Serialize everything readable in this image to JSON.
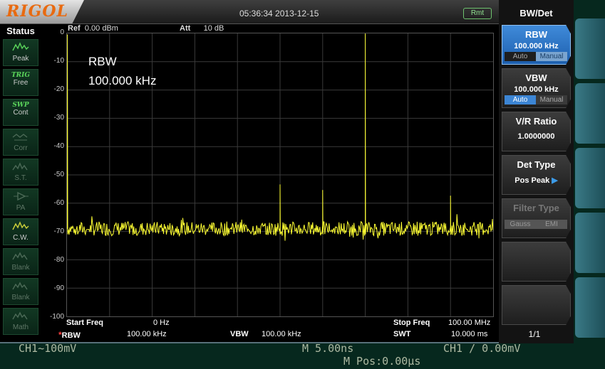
{
  "header": {
    "brand": "RIGOL",
    "datetime": "05:36:34 2013-12-15",
    "rmt": "Rmt"
  },
  "status": {
    "title": "Status",
    "items": [
      {
        "label": "Peak",
        "icon": "peak-icon",
        "active": true
      },
      {
        "tag": "TRIG",
        "label": "Free",
        "active": true
      },
      {
        "tag": "SWP",
        "label": "Cont",
        "active": true
      },
      {
        "label": "Corr",
        "icon": "corr-icon",
        "active": false
      },
      {
        "label": "S.T.",
        "icon": "st-icon",
        "active": false
      },
      {
        "label": "PA",
        "icon": "pa-icon",
        "active": false
      },
      {
        "label": "C.W.",
        "icon": "cw-icon",
        "active": true
      },
      {
        "label": "Blank",
        "icon": "blank-icon",
        "active": false
      },
      {
        "label": "Blank",
        "icon": "blank-icon",
        "active": false
      },
      {
        "label": "Math",
        "icon": "math-icon",
        "active": false
      }
    ]
  },
  "plot_header": {
    "ref_label": "Ref",
    "ref_value": "0.00 dBm",
    "att_label": "Att",
    "att_value": "10 dB"
  },
  "overlay": {
    "line1": "RBW",
    "line2": "100.000 kHz"
  },
  "footer": {
    "start_label": "Start Freq",
    "start_value": "0 Hz",
    "stop_label": "Stop Freq",
    "stop_value": "100.00 MHz",
    "rbw_marker": "*",
    "rbw_label": "RBW",
    "rbw_value": "100.00 kHz",
    "vbw_label": "VBW",
    "vbw_value": "100.00 kHz",
    "swt_label": "SWT",
    "swt_value": "10.000 ms"
  },
  "menu": {
    "title": "BW/Det",
    "buttons": [
      {
        "title": "RBW",
        "value": "100.000 kHz",
        "toggle": [
          "Auto",
          "Manual"
        ],
        "selected": 1,
        "active": true
      },
      {
        "title": "VBW",
        "value": "100.000 kHz",
        "toggle": [
          "Auto",
          "Manual"
        ],
        "selected": 0
      },
      {
        "title": "V/R Ratio",
        "value": "1.0000000"
      },
      {
        "title": "Det Type",
        "value": "Pos Peak"
      },
      {
        "title": "Filter Type",
        "toggle": [
          "Gauss",
          "EMI"
        ],
        "disabled": true
      }
    ],
    "page": "1/1"
  },
  "scope": {
    "ch1_scale": "CH1~100mV",
    "timebase": "M 5.00ns",
    "trigger": "CH1 / 0.00mV",
    "mpos": "M Pos:0.00μs"
  },
  "colors": {
    "trace": "#ffff33",
    "grid": "#3a3a3a",
    "menu_active": "#2f7bd0"
  },
  "chart_data": {
    "type": "line",
    "title": "",
    "xlabel": "",
    "ylabel": "",
    "x_unit": "MHz",
    "y_unit": "dBm",
    "xlim": [
      0,
      100
    ],
    "ylim": [
      -100,
      0
    ],
    "y_ticks": [
      "0",
      "-10",
      "-20",
      "-30",
      "-40",
      "-50",
      "-60",
      "-70",
      "-80",
      "-90",
      "-100"
    ],
    "grid": true,
    "noise_floor": -69,
    "peaks": [
      {
        "x": 0.1,
        "y": -0.5
      },
      {
        "x": 50.0,
        "y": -53.5
      },
      {
        "x": 60.0,
        "y": -55.5
      },
      {
        "x": 70.0,
        "y": -0.2
      },
      {
        "x": 90.0,
        "y": -57.5
      }
    ]
  }
}
